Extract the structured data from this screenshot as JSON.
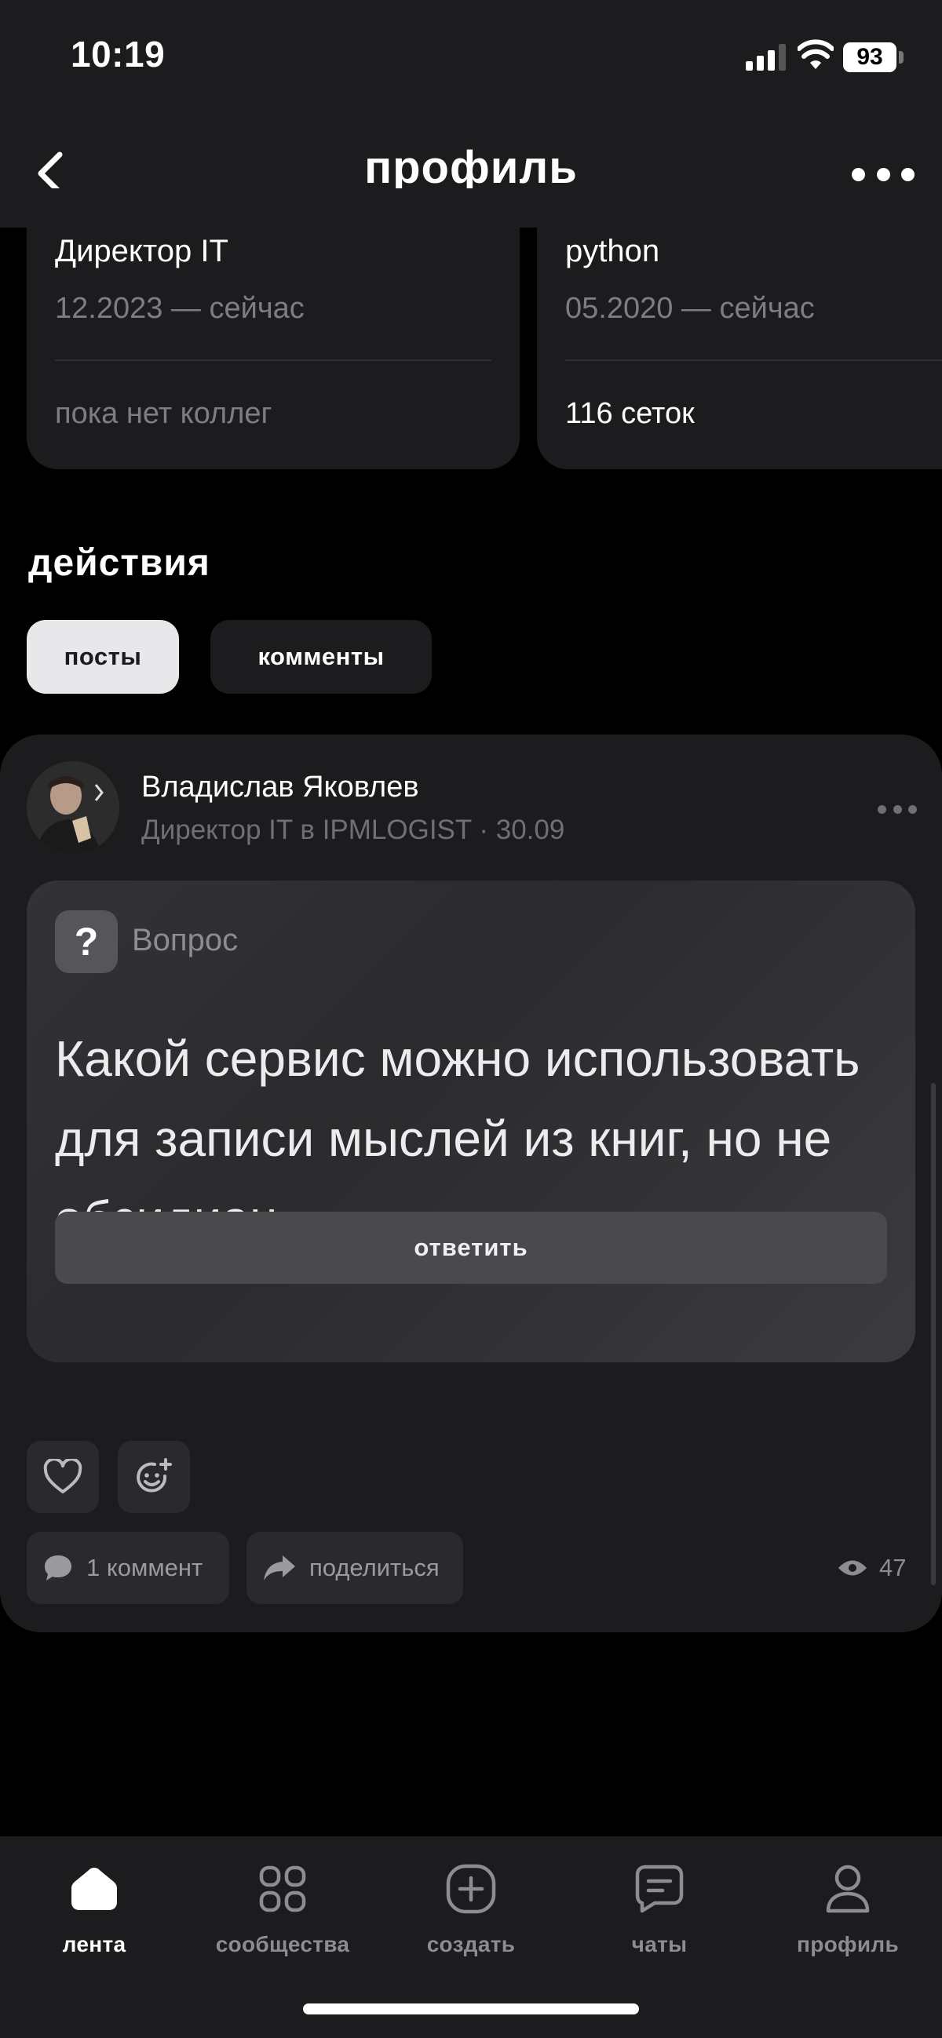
{
  "status_bar": {
    "time": "10:19",
    "battery": "93"
  },
  "header": {
    "title": "профиль"
  },
  "experience": [
    {
      "title": "Директор IT",
      "dates": "12.2023 — сейчас",
      "footer": "пока нет коллег"
    },
    {
      "title": "python",
      "dates": "05.2020 — сейчас",
      "footer": "116 сеток"
    }
  ],
  "actions": {
    "title": "действия",
    "tabs": [
      {
        "label": "посты",
        "active": true
      },
      {
        "label": "комменты",
        "active": false
      }
    ]
  },
  "post": {
    "author": "Владислав Яковлев",
    "meta": "Директор IT в IPMLOGIST · 30.09",
    "badge": "Вопрос",
    "question": "Какой сервис можно использовать для записи мыслей из книг, но не обсидиан",
    "reply_label": "ответить",
    "comments_label": "1 коммент",
    "share_label": "поделиться",
    "views": "47"
  },
  "bottom_nav": [
    {
      "label": "лента",
      "icon": "home-icon",
      "active": true
    },
    {
      "label": "сообщества",
      "icon": "grid-icon",
      "active": false
    },
    {
      "label": "создать",
      "icon": "plus-square-icon",
      "active": false
    },
    {
      "label": "чаты",
      "icon": "chat-icon",
      "active": false
    },
    {
      "label": "профиль",
      "icon": "person-icon",
      "active": false
    }
  ],
  "colors": {
    "background": "#000000",
    "surface": "#1c1c1e",
    "muted_text": "#7d7d82",
    "active_tab": "#e8e8ea"
  }
}
